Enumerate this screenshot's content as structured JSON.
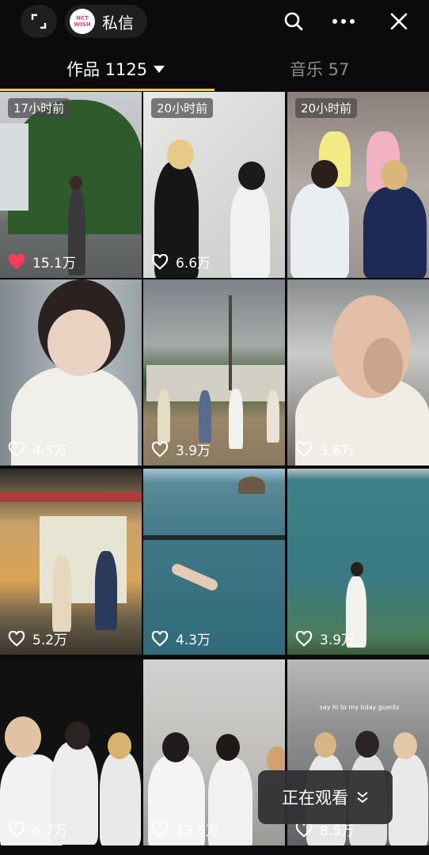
{
  "header": {
    "dm_logo_text": "NCT WISH",
    "dm_label": "私信"
  },
  "tabs": {
    "works_label": "作品 1125",
    "music_label": "音乐 57"
  },
  "colors": {
    "tab_underline": "#f2c94c",
    "liked_heart": "#ff3b5c",
    "background": "#0b0b0d"
  },
  "videos": [
    {
      "time": "17小时前",
      "likes": "15.1万",
      "liked": true
    },
    {
      "time": "20小时前",
      "likes": "6.6万",
      "liked": false
    },
    {
      "time": "20小时前",
      "likes": "",
      "liked": false
    },
    {
      "time": "",
      "likes": "4.5万",
      "liked": false
    },
    {
      "time": "",
      "likes": "3.9万",
      "liked": false
    },
    {
      "time": "",
      "likes": "3.6万",
      "liked": false
    },
    {
      "time": "",
      "likes": "5.2万",
      "liked": false
    },
    {
      "time": "",
      "likes": "4.3万",
      "liked": false
    },
    {
      "time": "",
      "likes": "3.9万",
      "liked": false
    },
    {
      "time": "",
      "likes": "6.7万",
      "liked": false
    },
    {
      "time": "",
      "likes": "13.5万",
      "liked": false
    },
    {
      "time": "",
      "likes": "8.5万",
      "liked": false
    }
  ],
  "overlay_text_cell12": "say hi to my bday guests",
  "watching_label": "正在观看"
}
